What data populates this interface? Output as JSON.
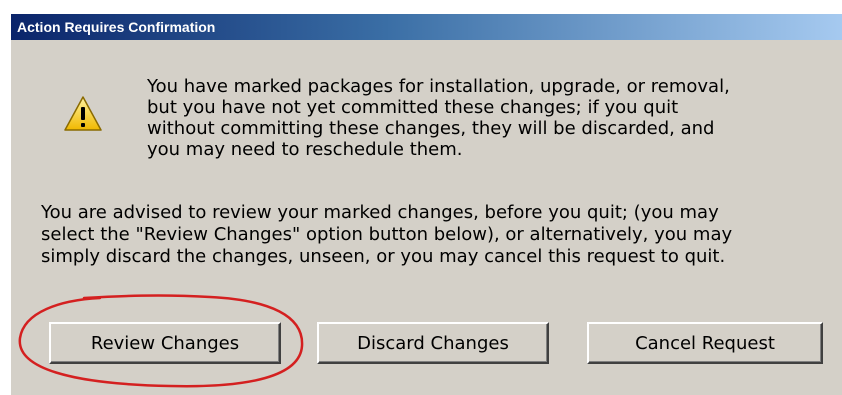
{
  "dialog": {
    "title": "Action Requires Confirmation",
    "icon": "warning-icon",
    "message": "You have marked packages for installation, upgrade, or removal,\nbut you have not yet committed these changes; if you quit\nwithout committing these changes, they will be discarded, and\nyou may need to reschedule them.",
    "advice": "You are advised to review your marked changes, before you quit; (you may\nselect the \"Review Changes\" option button below), or alternatively, you may\nsimply discard the changes, unseen, or you may cancel this request to quit."
  },
  "buttons": {
    "review": "Review Changes",
    "discard": "Discard Changes",
    "cancel": "Cancel Request"
  },
  "colors": {
    "title_bar_start": "#0a246a",
    "title_bar_end": "#a6caf0",
    "dialog_background": "#d4d0c8",
    "annotation_circle": "#d42020",
    "warning_fill": "#f5c400"
  }
}
